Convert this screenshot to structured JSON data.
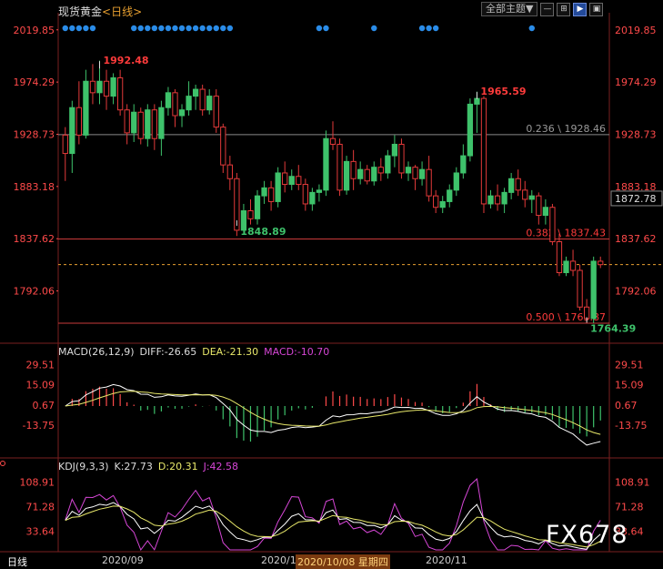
{
  "header": {
    "instrument": "现货黄金",
    "timeframe": "<日线>",
    "theme_select": "全部主题▼"
  },
  "toolbar_buttons": [
    {
      "name": "minimize-icon",
      "glyph": "—"
    },
    {
      "name": "grid-icon",
      "glyph": "⊞"
    },
    {
      "name": "arrow-right-icon",
      "glyph": "▶",
      "on": true
    },
    {
      "name": "window-icon",
      "glyph": "▣"
    }
  ],
  "colors": {
    "up": "#3ec26b",
    "down": "#e33a3a",
    "axis_text": "#ff4a4a",
    "fib_gray": "#999999",
    "fib_red": "#ff3b3b",
    "dot": "#2a8ce8",
    "macd_diff": "#ffffff",
    "macd_dea": "#e8e86a",
    "kdj_k": "#ffffff",
    "kdj_d": "#e8e86a",
    "kdj_j": "#d646d6"
  },
  "chart_data": [
    {
      "type": "candlestick",
      "title": "现货黄金",
      "ylim": [
        1752,
        2030
      ],
      "y_ticks": [
        "2019.85",
        "1974.29",
        "1928.73",
        "1883.18",
        "1837.62",
        "1792.06"
      ],
      "current_price": "1872.78",
      "candles": [
        [
          1928,
          1935,
          1888,
          1912
        ],
        [
          1912,
          1958,
          1895,
          1952
        ],
        [
          1952,
          1975,
          1920,
          1928
        ],
        [
          1928,
          1985,
          1925,
          1975
        ],
        [
          1975,
          1990,
          1955,
          1965
        ],
        [
          1965,
          1993,
          1955,
          1975
        ],
        [
          1975,
          1985,
          1950,
          1962
        ],
        [
          1962,
          1982,
          1955,
          1978
        ],
        [
          1978,
          1985,
          1945,
          1950
        ],
        [
          1950,
          1955,
          1920,
          1930
        ],
        [
          1930,
          1955,
          1922,
          1948
        ],
        [
          1948,
          1952,
          1920,
          1925
        ],
        [
          1925,
          1955,
          1918,
          1950
        ],
        [
          1950,
          1955,
          1915,
          1925
        ],
        [
          1925,
          1958,
          1910,
          1952
        ],
        [
          1952,
          1970,
          1945,
          1965
        ],
        [
          1965,
          1968,
          1935,
          1945
        ],
        [
          1945,
          1955,
          1935,
          1950
        ],
        [
          1950,
          1975,
          1945,
          1962
        ],
        [
          1962,
          1972,
          1950,
          1968
        ],
        [
          1968,
          1972,
          1945,
          1950
        ],
        [
          1950,
          1968,
          1946,
          1962
        ],
        [
          1962,
          1968,
          1930,
          1935
        ],
        [
          1935,
          1938,
          1895,
          1902
        ],
        [
          1902,
          1910,
          1880,
          1890
        ],
        [
          1890,
          1895,
          1840,
          1845
        ],
        [
          1845,
          1868,
          1842,
          1862
        ],
        [
          1862,
          1872,
          1850,
          1855
        ],
        [
          1855,
          1880,
          1850,
          1875
        ],
        [
          1875,
          1888,
          1868,
          1882
        ],
        [
          1882,
          1888,
          1862,
          1870
        ],
        [
          1870,
          1900,
          1865,
          1895
        ],
        [
          1895,
          1905,
          1878,
          1885
        ],
        [
          1885,
          1898,
          1880,
          1892
        ],
        [
          1892,
          1902,
          1880,
          1885
        ],
        [
          1885,
          1890,
          1862,
          1868
        ],
        [
          1868,
          1882,
          1862,
          1878
        ],
        [
          1878,
          1885,
          1870,
          1880
        ],
        [
          1880,
          1932,
          1875,
          1925
        ],
        [
          1925,
          1940,
          1915,
          1920
        ],
        [
          1920,
          1925,
          1875,
          1880
        ],
        [
          1880,
          1910,
          1876,
          1905
        ],
        [
          1905,
          1915,
          1880,
          1890
        ],
        [
          1890,
          1905,
          1885,
          1898
        ],
        [
          1898,
          1902,
          1885,
          1888
        ],
        [
          1888,
          1905,
          1884,
          1900
        ],
        [
          1900,
          1908,
          1888,
          1895
        ],
        [
          1895,
          1915,
          1890,
          1910
        ],
        [
          1910,
          1928,
          1900,
          1920
        ],
        [
          1920,
          1925,
          1890,
          1895
        ],
        [
          1895,
          1905,
          1888,
          1900
        ],
        [
          1900,
          1902,
          1880,
          1890
        ],
        [
          1890,
          1905,
          1884,
          1898
        ],
        [
          1898,
          1910,
          1870,
          1875
        ],
        [
          1875,
          1880,
          1860,
          1865
        ],
        [
          1865,
          1875,
          1860,
          1870
        ],
        [
          1870,
          1885,
          1865,
          1880
        ],
        [
          1880,
          1900,
          1875,
          1895
        ],
        [
          1895,
          1920,
          1890,
          1910
        ],
        [
          1910,
          1960,
          1905,
          1955
        ],
        [
          1955,
          1966,
          1930,
          1960
        ],
        [
          1960,
          1962,
          1860,
          1868
        ],
        [
          1868,
          1880,
          1864,
          1875
        ],
        [
          1875,
          1885,
          1862,
          1868
        ],
        [
          1868,
          1882,
          1860,
          1878
        ],
        [
          1878,
          1895,
          1872,
          1890
        ],
        [
          1890,
          1898,
          1875,
          1880
        ],
        [
          1880,
          1888,
          1865,
          1872
        ],
        [
          1872,
          1880,
          1860,
          1875
        ],
        [
          1875,
          1878,
          1850,
          1858
        ],
        [
          1858,
          1872,
          1850,
          1865
        ],
        [
          1865,
          1868,
          1832,
          1835
        ],
        [
          1835,
          1842,
          1805,
          1808
        ],
        [
          1808,
          1822,
          1805,
          1818
        ],
        [
          1818,
          1828,
          1805,
          1810
        ],
        [
          1810,
          1815,
          1775,
          1778
        ],
        [
          1778,
          1785,
          1764,
          1768
        ],
        [
          1768,
          1822,
          1764,
          1818
        ],
        [
          1818,
          1822,
          1812,
          1815
        ]
      ],
      "fib_levels": [
        {
          "price": 1928.46,
          "label": "0.236 \\ 1928.46",
          "color": "gray"
        },
        {
          "price": 1837.43,
          "label": "0.382 \\ 1837.43",
          "color": "red"
        },
        {
          "price": 1763.87,
          "label": "0.500 \\ 1763.87",
          "color": "red"
        }
      ],
      "annotations": [
        {
          "label": "1992.48",
          "price": 1992.48,
          "index": 5,
          "color": "red"
        },
        {
          "label": "1965.59",
          "price": 1965.59,
          "index": 60,
          "color": "red"
        },
        {
          "label": "1848.89",
          "price": 1848.89,
          "index": 25,
          "color": "green"
        },
        {
          "label": "1764.39",
          "price": 1764.39,
          "index": 76,
          "color": "green"
        }
      ],
      "dots_on": [
        0,
        1,
        2,
        3,
        4,
        10,
        11,
        12,
        13,
        14,
        15,
        16,
        17,
        18,
        19,
        20,
        21,
        22,
        23,
        24,
        37,
        38,
        45,
        52,
        53,
        54,
        68
      ],
      "ref_price_dashed": 1815
    },
    {
      "type": "macd",
      "legend": {
        "name": "MACD(26,12,9)",
        "diff": "DIFF:-26.65",
        "dea": "DEA:-21.30",
        "macd": "MACD:-10.70"
      },
      "ylim": [
        -35,
        35
      ],
      "y_ticks": [
        "29.51",
        "15.09",
        "0.67",
        "-13.75"
      ]
    },
    {
      "type": "kdj",
      "legend": {
        "name": "KDJ(9,3,3)",
        "k": "K:27.73",
        "d": "D:20.31",
        "j": "J:42.58"
      },
      "ylim": [
        5,
        125
      ],
      "y_ticks": [
        "108.91",
        "71.28",
        "33.64"
      ]
    }
  ],
  "x_axis": {
    "labels": [
      "2020/09",
      "2020/1",
      "2020/11"
    ],
    "highlight": "2020/10/08 星期四"
  },
  "status": {
    "daily_label": "日线"
  },
  "watermark": "FX678"
}
